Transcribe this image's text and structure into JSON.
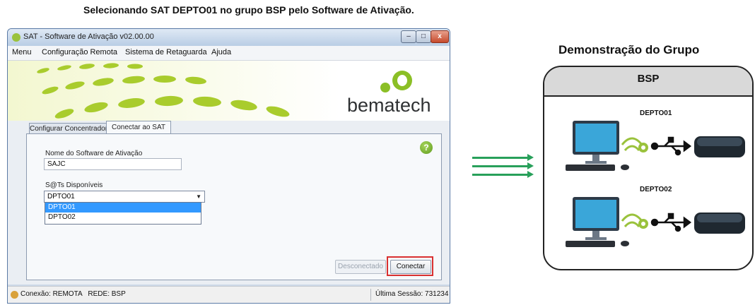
{
  "caption": "Selecionando SAT DEPTO01 no grupo BSP pelo Software de Ativação.",
  "window": {
    "title": "SAT - Software de Ativação v02.00.00",
    "controls": {
      "minimize": "–",
      "maximize": "□",
      "close": "x"
    }
  },
  "menu": [
    "Menu",
    "Configuração Remota",
    "Sistema de Retaguarda",
    "Ajuda"
  ],
  "banner": {
    "logo_text": "bematech"
  },
  "tabs": [
    {
      "label": "Configurar Concentrador",
      "active": false
    },
    {
      "label": "Conectar ao SAT",
      "active": true
    }
  ],
  "form": {
    "name_label": "Nome do Software de Ativação",
    "name_value": "SAJC",
    "sats_label": "S@Ts Disponíveis",
    "selected": "DPTO01",
    "options": [
      "DPTO01",
      "DPTO02"
    ],
    "help": "?"
  },
  "buttons": {
    "disconnected": "Desconectado",
    "connect": "Conectar"
  },
  "status": {
    "left": "Conexão: REMOTA   REDE: BSP",
    "right": "Última Sessão: 731234"
  },
  "group": {
    "title": "Demonstração do Grupo",
    "name": "BSP",
    "devices": [
      "DEPTO01",
      "DEPTO02"
    ]
  },
  "colors": {
    "accent_green": "#28a05a",
    "highlight_red": "#d93030",
    "selection_blue": "#3399ff"
  }
}
